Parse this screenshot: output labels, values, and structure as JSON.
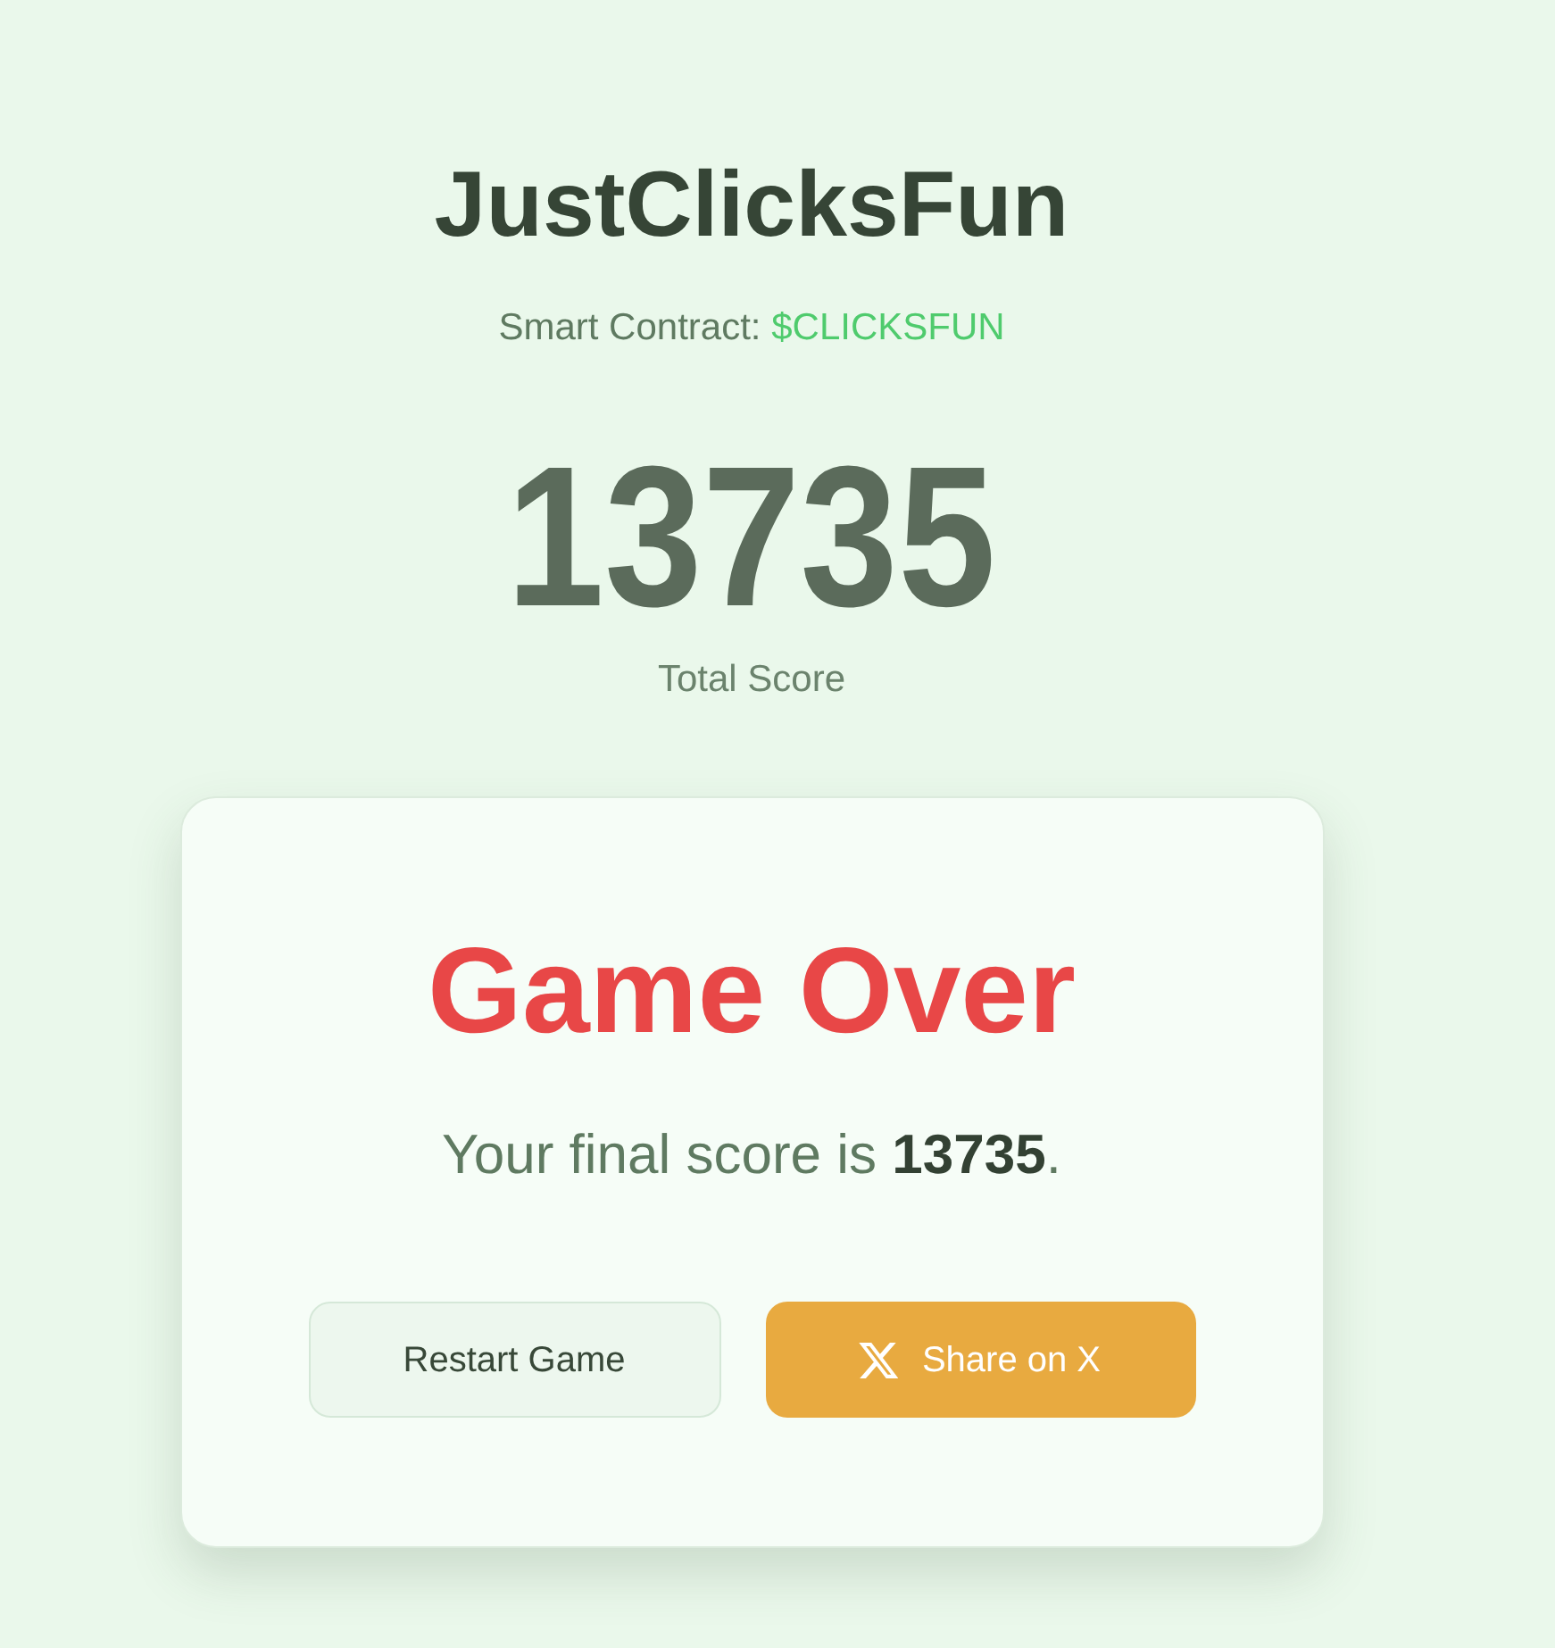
{
  "header": {
    "title": "JustClicksFun",
    "contract_label": "Smart Contract:",
    "contract_value": "$CLICKSFUN"
  },
  "score": {
    "value": "13735",
    "label": "Total Score"
  },
  "dialog": {
    "title": "Game Over",
    "message": "Your final score is **13735**.",
    "buttons": [
      {
        "label": "Restart Game",
        "kind": "secondary"
      },
      {
        "label": "Share on X",
        "kind": "primary"
      }
    ]
  }
}
